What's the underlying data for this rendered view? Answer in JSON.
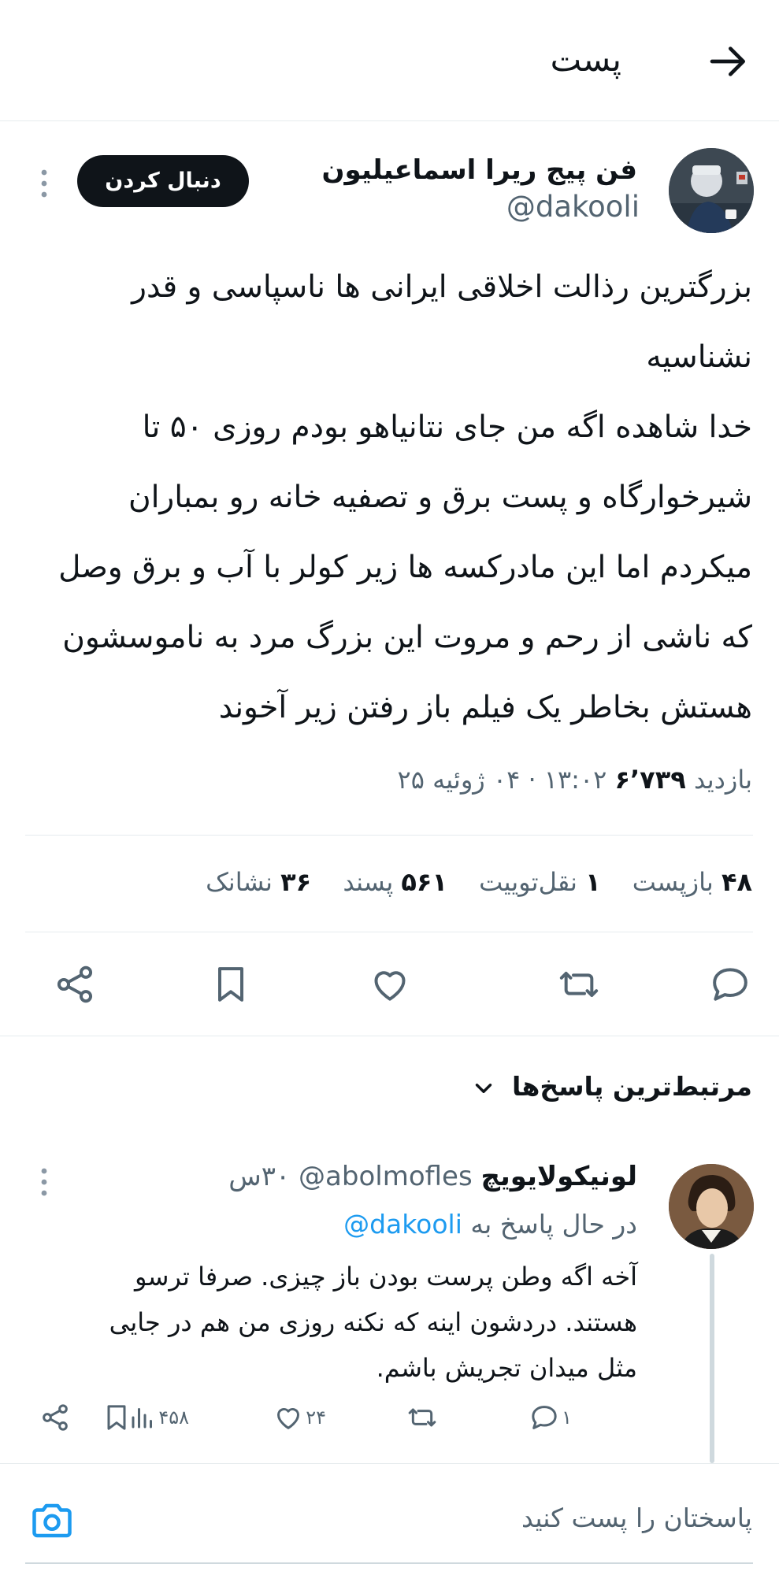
{
  "header": {
    "title": "پست"
  },
  "post": {
    "author_name": "فن پیج ریرا اسماعیلیون",
    "author_handle": "@dakooli",
    "follow_label": "دنبال کردن",
    "body_lines": [
      "بزرگترین رذالت اخلاقی ایرانی ها ناسپاسی و قدر",
      "نشناسیه",
      "خدا شاهده اگه من جای نتانیاهو بودم روزی ۵۰ تا",
      "شیرخوارگاه و پست برق و تصفیه خانه رو بمباران",
      "میکردم اما این مادرکسه ها زیر کولر با آب و برق وصل",
      "که ناشی از رحم و مروت این بزرگ مرد به ناموسشون",
      "هستش بخاطر یک فیلم باز رفتن زیر آخوند"
    ],
    "views_label": "بازدید",
    "views_count": "۶٬۷۳۹",
    "timestamp": "۱۳:۰۲ · ۰۴ ژوئیه ۲۵",
    "stats": {
      "reposts_count": "۴۸",
      "reposts_label": "بازپست",
      "quotes_count": "۱",
      "quotes_label": "نقل‌توییت",
      "likes_count": "۵۶۱",
      "likes_label": "پسند",
      "bookmarks_count": "۳۶",
      "bookmarks_label": "نشانک"
    },
    "actions": [
      "reply-icon",
      "repost-icon",
      "like-icon",
      "bookmark-icon",
      "share-icon"
    ]
  },
  "replies_section": {
    "sort_label": "مرتبط‌ترین پاسخ‌ها"
  },
  "reply": {
    "author_name": "لونیکولایویچ",
    "author_handle": "@abolmofles",
    "time": "۳۰س",
    "replying_to_label": "در حال پاسخ به",
    "replying_to_handle": "@dakooli",
    "body": "آخه اگه وطن پرست بودن باز چیزی. صرفا ترسو هستند. دردشون اینه که نکنه روزی من هم در جایی مثل میدان تجریش باشم.",
    "reply_count": "۱",
    "like_count": "۲۴",
    "views_count": "۴۵۸"
  },
  "compose": {
    "placeholder": "پاسختان را پست کنید"
  },
  "colors": {
    "text": "#0f1419",
    "muted": "#536471",
    "accent": "#1d9bf0",
    "divider": "#e6ebee"
  }
}
